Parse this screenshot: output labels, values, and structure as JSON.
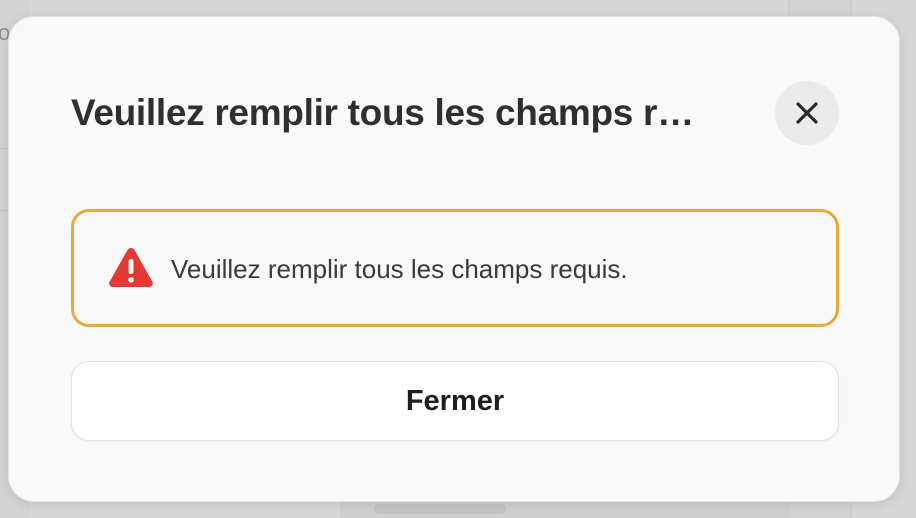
{
  "background": {
    "left_text_fragment": "o"
  },
  "dialog": {
    "title": "Veuillez remplir tous les champs r…",
    "close_icon": "close-icon",
    "alert": {
      "icon": "warning-triangle-icon",
      "icon_color": "#e53935",
      "border_color": "#eaa93c",
      "message": "Veuillez remplir tous les champs requis."
    },
    "close_button_label": "Fermer"
  }
}
